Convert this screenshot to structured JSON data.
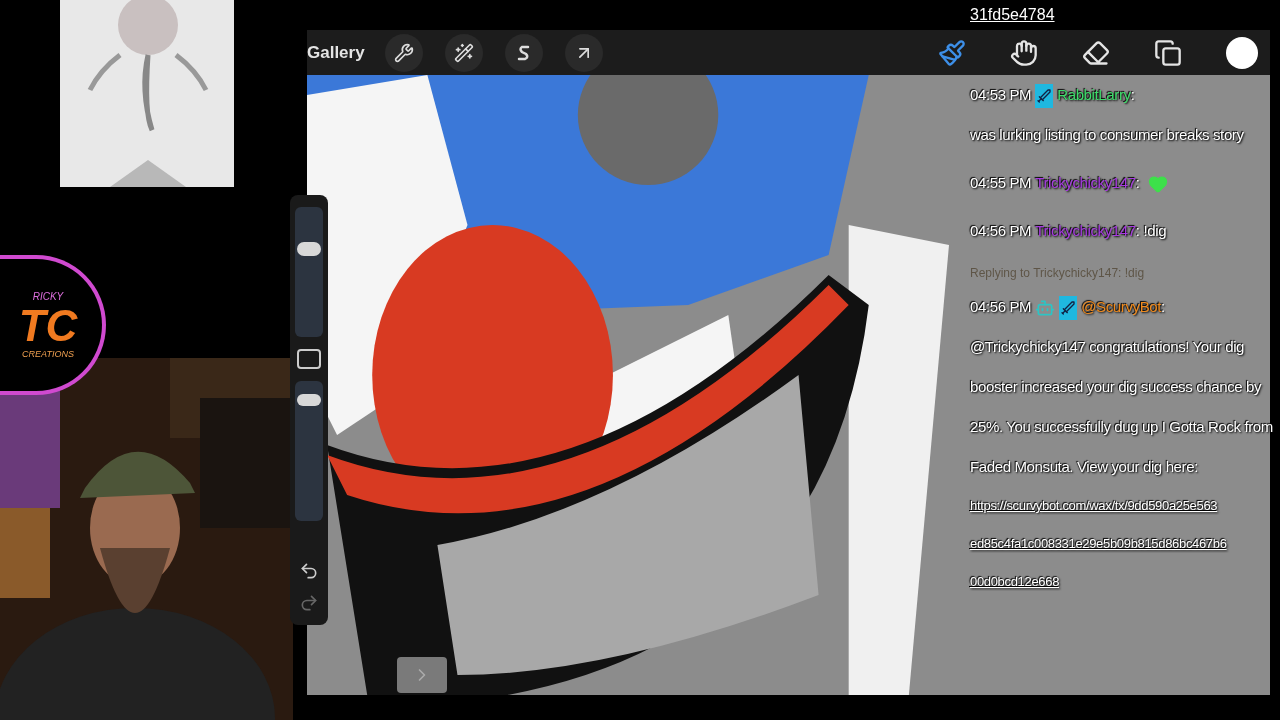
{
  "logo": {
    "texts": [
      "RICKY",
      "TC",
      "CREATIONS"
    ]
  },
  "app": {
    "gallery_label": "Gallery",
    "left_tools": [
      {
        "kind": "wrench"
      },
      {
        "kind": "wand"
      },
      {
        "kind": "selection"
      },
      {
        "kind": "transform"
      }
    ],
    "right_tools": [
      {
        "kind": "brush",
        "selected": true
      },
      {
        "kind": "smudge",
        "selected": false
      },
      {
        "kind": "eraser",
        "selected": false
      },
      {
        "kind": "layers",
        "selected": false
      },
      {
        "kind": "color",
        "selected": false
      }
    ],
    "sidebar": {
      "size_slider": {
        "level": 0.7
      },
      "opacity_slider": {
        "level": 0.9
      }
    }
  },
  "chat": {
    "top_fragment": "31fd5e4784",
    "messages": [
      {
        "kind": "message",
        "time": "04:53 PM",
        "bot_badge": false,
        "sword_badge": true,
        "user": "RabbitLarry",
        "color": "#3ddc6a",
        "separator": ":",
        "text": "was lurking listing to consumer breaks story",
        "heart": false
      },
      {
        "kind": "message",
        "time": "04:55 PM",
        "bot_badge": false,
        "sword_badge": false,
        "user": "Trickychicky147",
        "color": "#a63ae0",
        "separator": ":",
        "heart": true
      },
      {
        "kind": "message",
        "time": "04:56 PM",
        "bot_badge": false,
        "sword_badge": false,
        "user": "Trickychicky147",
        "color": "#a63ae0",
        "separator": ":",
        "text": "!dig",
        "heart": false
      },
      {
        "kind": "reply",
        "text": "Replying to Trickychicky147: !dig"
      },
      {
        "kind": "message",
        "time": "04:56 PM",
        "bot_badge": true,
        "sword_badge": true,
        "user": "@ScurvyBot",
        "color": "#f08a1c",
        "separator": ":",
        "text": "@Trickychicky147 congratulations! Your dig booster increased your dig success chance by 25%. You successfully dug up I Gotta Rock from Faded Monsuta. View your dig here:",
        "heart": false,
        "links": [
          "https://scurvybot.com/wax/tx/9dd590a25e563",
          "ed85c4fa1c008331e29e5b09b815d86bc467b6",
          "00d0bcd12e668"
        ]
      }
    ]
  }
}
